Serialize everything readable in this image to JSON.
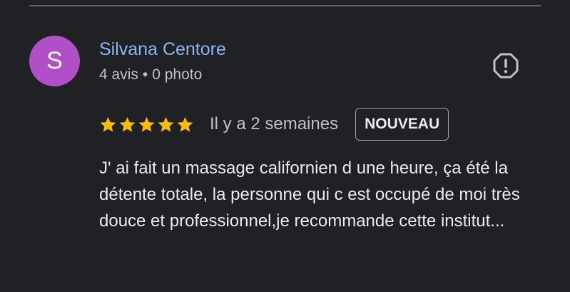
{
  "review": {
    "author": {
      "initial": "S",
      "name": "Silvana Centore",
      "avatar_color": "#b04fc7",
      "reviews_count": "4 avis",
      "separator": "•",
      "photos_count": "0 photo"
    },
    "report_icon": "report-flag-icon",
    "rating": 5,
    "rating_max": 5,
    "star_color": "#fbbc04",
    "date": "Il y a 2 semaines",
    "badge": "NOUVEAU",
    "text": "J' ai fait un massage californien d une heure, ça été la détente totale, la personne qui c est occupé de moi très douce et professionnel,je recommande cette institut..."
  }
}
